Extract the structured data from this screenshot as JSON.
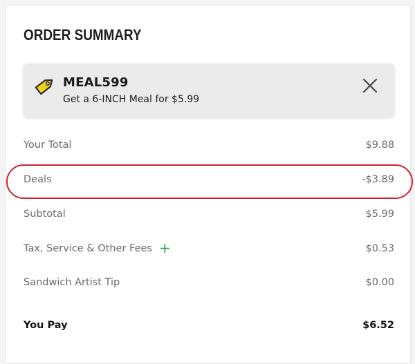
{
  "summary": {
    "title": "ORDER SUMMARY"
  },
  "promo": {
    "code": "MEAL599",
    "description": "Get a 6-INCH Meal for $5.99",
    "icon": "price-tag-icon",
    "icon_color": "#f4d21b",
    "close_icon": "close-icon"
  },
  "lines": {
    "your_total": {
      "label": "Your Total",
      "value": "$9.88"
    },
    "deals": {
      "label": "Deals",
      "value": "-$3.89"
    },
    "subtotal": {
      "label": "Subtotal",
      "value": "$5.99"
    },
    "tax_fees": {
      "label": "Tax, Service & Other Fees",
      "value": "$0.53",
      "expand_icon": "plus-icon"
    },
    "tip": {
      "label": "Sandwich Artist Tip",
      "value": "$0.00"
    },
    "you_pay": {
      "label": "You Pay",
      "value": "$6.52"
    }
  },
  "colors": {
    "highlight_ring": "#cf1f33",
    "plus_icon": "#2aa14a",
    "promo_background": "#ebebeb"
  }
}
